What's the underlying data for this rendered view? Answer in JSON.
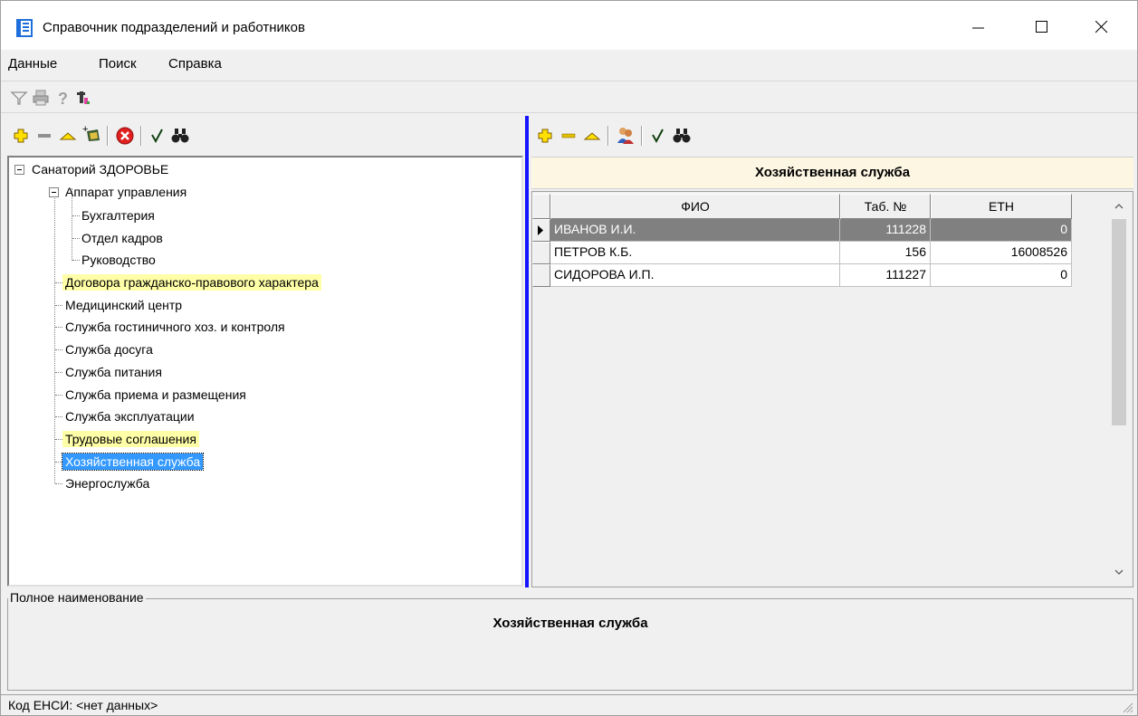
{
  "window": {
    "title": "Справочник подразделений и работников"
  },
  "menu": [
    "Данные",
    "Поиск",
    "Справка"
  ],
  "tree": {
    "root": "Санаторий ЗДОРОВЬЕ",
    "items": [
      {
        "label": "Аппарат управления",
        "level": 1,
        "expanded": true
      },
      {
        "label": "Бухгалтерия",
        "level": 2
      },
      {
        "label": "Отдел кадров",
        "level": 2
      },
      {
        "label": "Руководство",
        "level": 2
      },
      {
        "label": "Договора гражданско-правового характера",
        "level": 1,
        "highlight": true
      },
      {
        "label": "Медицинский центр",
        "level": 1
      },
      {
        "label": "Служба гостиничного хоз. и контроля",
        "level": 1
      },
      {
        "label": "Служба досуга",
        "level": 1
      },
      {
        "label": "Служба питания",
        "level": 1
      },
      {
        "label": "Служба приема и размещения",
        "level": 1
      },
      {
        "label": "Служба эксплуатации",
        "level": 1
      },
      {
        "label": "Трудовые соглашения",
        "level": 1,
        "highlight": true
      },
      {
        "label": "Хозяйственная служба",
        "level": 1,
        "selected": true
      },
      {
        "label": "Энергослужба",
        "level": 1
      }
    ]
  },
  "right": {
    "header": "Хозяйственная служба",
    "columns": [
      "ФИО",
      "Таб. №",
      "ЕТН"
    ],
    "rows": [
      {
        "fio": "ИВАНОВ И.И.",
        "tab": "111228",
        "etn": "0",
        "selected": true
      },
      {
        "fio": "ПЕТРОВ К.Б.",
        "tab": "156",
        "etn": "16008526"
      },
      {
        "fio": "СИДОРОВА И.П.",
        "tab": "111227",
        "etn": "0"
      }
    ]
  },
  "bottom": {
    "group_label": "Полное наименование",
    "full_name": "Хозяйственная служба"
  },
  "status": {
    "text": "Код ЕНСИ: <нет данных>"
  },
  "colors": {
    "splitter": "#1414ff",
    "highlight": "#ffffa8",
    "selection": "#3399ff",
    "grid_selection": "#808080"
  },
  "icons": {
    "main_toolbar": [
      "filter-icon",
      "print-icon",
      "help-icon",
      "person-icon"
    ],
    "left_toolbar": [
      "add-icon",
      "remove-icon",
      "edit-icon",
      "add-folder-icon",
      "delete-icon",
      "check-icon",
      "binoculars-icon"
    ],
    "right_toolbar": [
      "add-icon",
      "remove-icon",
      "edit-icon",
      "people-icon",
      "check-icon",
      "binoculars-icon"
    ]
  }
}
